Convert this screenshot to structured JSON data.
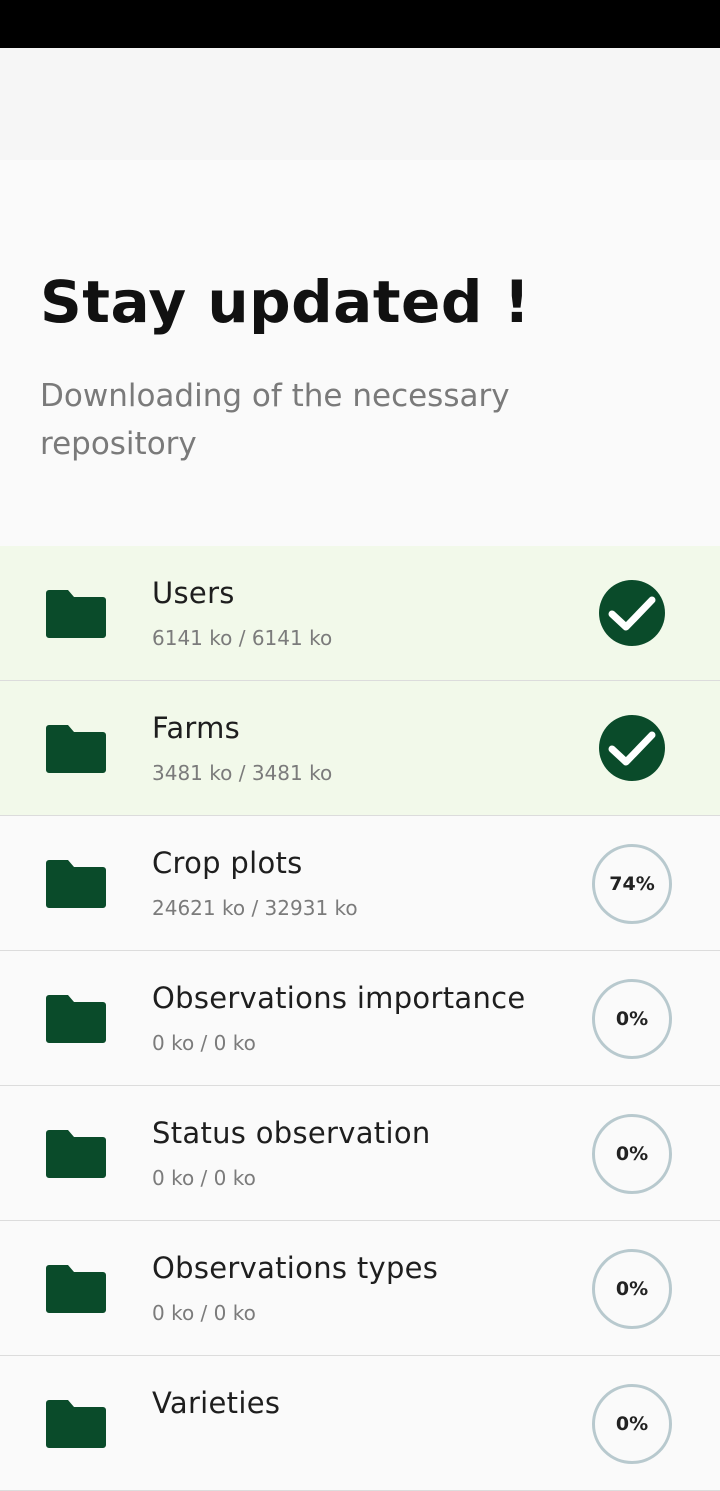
{
  "header": {
    "title": "Stay updated !",
    "subtitle": "Downloading of the necessary repository"
  },
  "colors": {
    "accent": "#0a4b2a",
    "done_row_bg": "#f2f9ea",
    "progress_ring": "#b8c9ce"
  },
  "repositories": [
    {
      "name": "Users",
      "size": "6141 ko / 6141 ko",
      "status": "done",
      "progress_label": "",
      "icon": "folder-icon"
    },
    {
      "name": "Farms",
      "size": "3481 ko / 3481 ko",
      "status": "done",
      "progress_label": "",
      "icon": "folder-icon"
    },
    {
      "name": "Crop plots",
      "size": "24621 ko / 32931 ko",
      "status": "progress",
      "progress_label": "74%",
      "icon": "folder-icon"
    },
    {
      "name": "Observations importance",
      "size": "0 ko / 0 ko",
      "status": "progress",
      "progress_label": "0%",
      "icon": "folder-icon"
    },
    {
      "name": "Status observation",
      "size": "0 ko / 0 ko",
      "status": "progress",
      "progress_label": "0%",
      "icon": "folder-icon"
    },
    {
      "name": "Observations types",
      "size": "0 ko / 0 ko",
      "status": "progress",
      "progress_label": "0%",
      "icon": "folder-icon"
    },
    {
      "name": "Varieties",
      "size": "",
      "status": "progress",
      "progress_label": "0%",
      "icon": "folder-icon"
    }
  ]
}
